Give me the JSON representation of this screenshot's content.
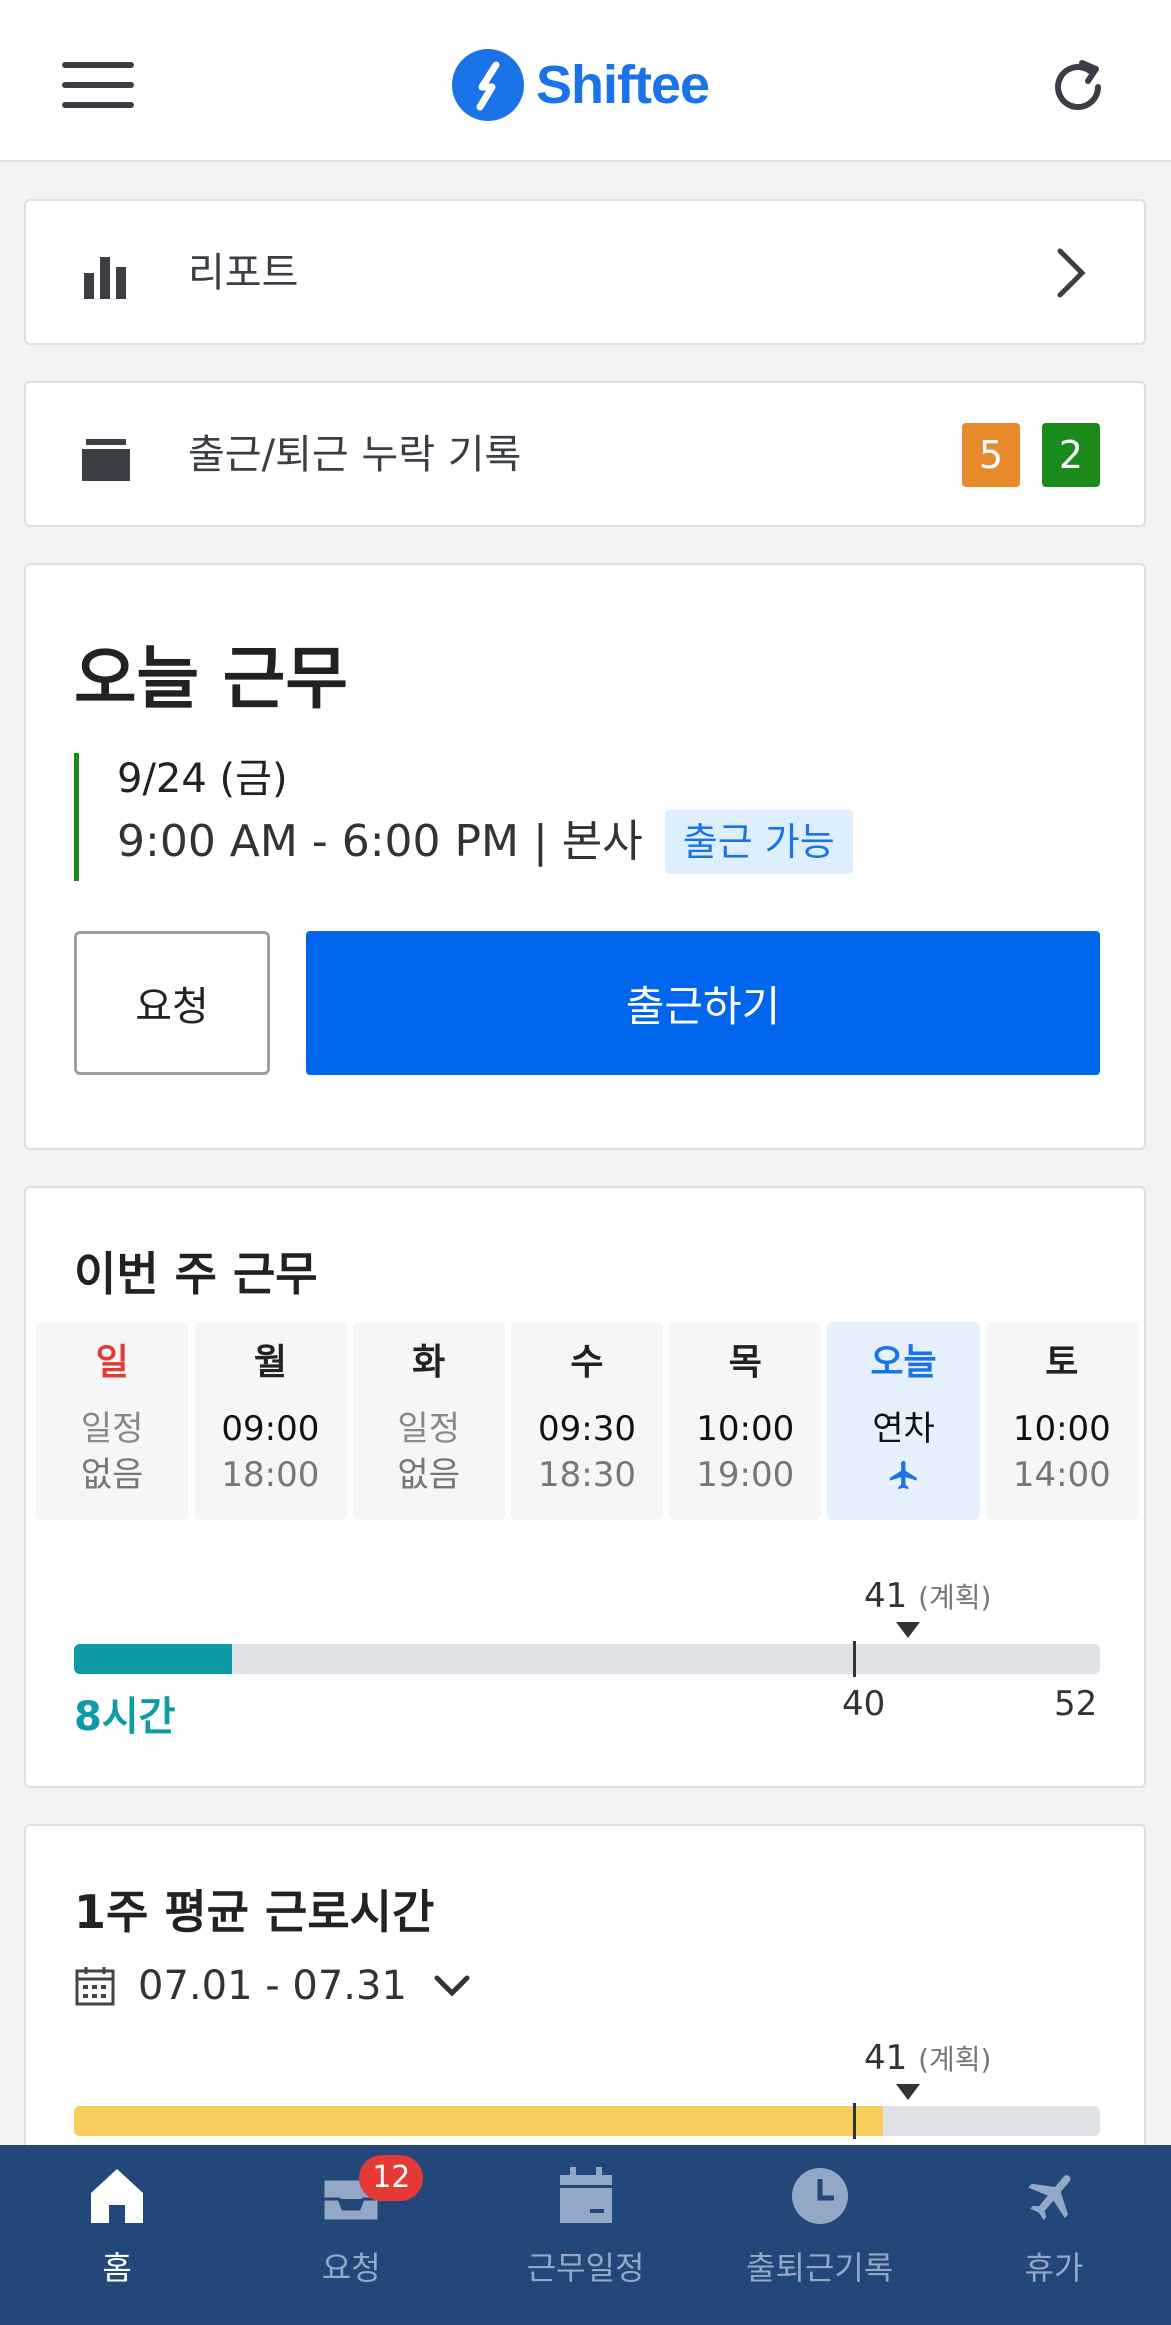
{
  "header": {
    "app_name": "Shiftee"
  },
  "report": {
    "label": "리포트"
  },
  "missing": {
    "label": "출근/퇴근 누락 기록",
    "badge_orange": "5",
    "badge_green": "2",
    "orange_color": "#e8892b",
    "green_color": "#1a8a1a"
  },
  "today": {
    "title": "오늘 근무",
    "date": "9/24 (금)",
    "time": "9:00 AM - 6:00 PM | 본사",
    "status_tag": "출근 가능",
    "request_button": "요청",
    "clockin_button": "출근하기"
  },
  "week": {
    "title": "이번 주 근무",
    "days": [
      {
        "name": "일",
        "line1": "일정",
        "line2": "없음"
      },
      {
        "name": "월",
        "line1": "09:00",
        "line2": "18:00"
      },
      {
        "name": "화",
        "line1": "일정",
        "line2": "없음"
      },
      {
        "name": "수",
        "line1": "09:30",
        "line2": "18:30"
      },
      {
        "name": "목",
        "line1": "10:00",
        "line2": "19:00"
      },
      {
        "name": "오늘",
        "line1": "연차",
        "line2": ""
      },
      {
        "name": "토",
        "line1": "10:00",
        "line2": "14:00"
      }
    ],
    "planned_value": "41",
    "planned_suffix": "(계획)",
    "worked_label": "8시간",
    "axis_mid": "40",
    "axis_max": "52",
    "worked_hours": 8,
    "planned_hours": 41,
    "max_hours": 52,
    "fill_color": "#0e9aa7"
  },
  "average": {
    "title": "1주 평균 근로시간",
    "range": "07.01 - 07.31",
    "planned_value": "41",
    "planned_suffix": "(계획)",
    "fill_color": "#f7cd5e"
  },
  "nav": {
    "items": [
      {
        "label": "홈",
        "icon": "home-icon"
      },
      {
        "label": "요청",
        "icon": "inbox-icon",
        "badge": "12"
      },
      {
        "label": "근무일정",
        "icon": "calendar-icon"
      },
      {
        "label": "출퇴근기록",
        "icon": "clock-icon"
      },
      {
        "label": "휴가",
        "icon": "airplane-icon"
      }
    ]
  }
}
